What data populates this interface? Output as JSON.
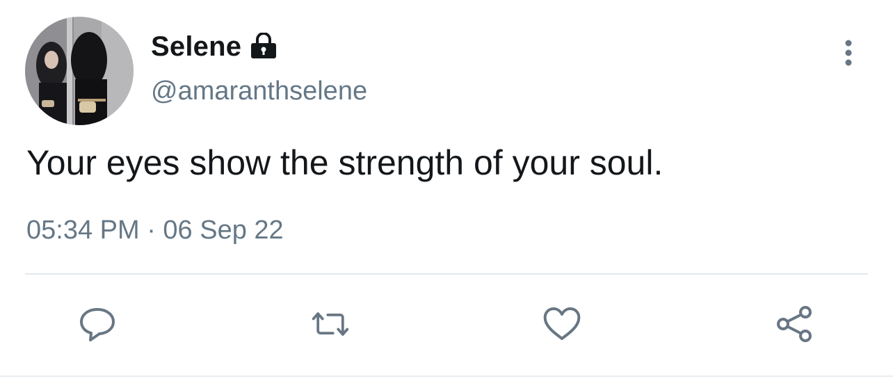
{
  "user": {
    "display_name": "Selene",
    "handle": "@amaranthselene",
    "protected": true,
    "lock_icon": "lock-icon",
    "avatar": "profile-photo"
  },
  "tweet": {
    "text": "Your eyes show the strength of your soul.",
    "timestamp": "05:34 PM · 06 Sep 22"
  },
  "menu": {
    "icon": "vertical-ellipsis-icon"
  },
  "actions": [
    {
      "name": "reply",
      "icon": "speech-bubble-icon"
    },
    {
      "name": "retweet",
      "icon": "retweet-arrows-icon"
    },
    {
      "name": "like",
      "icon": "heart-icon"
    },
    {
      "name": "share",
      "icon": "share-nodes-icon"
    }
  ],
  "colors": {
    "text_primary": "#14171a",
    "text_secondary": "#657786",
    "icon": "#687684",
    "divider": "#e1e8ed"
  }
}
